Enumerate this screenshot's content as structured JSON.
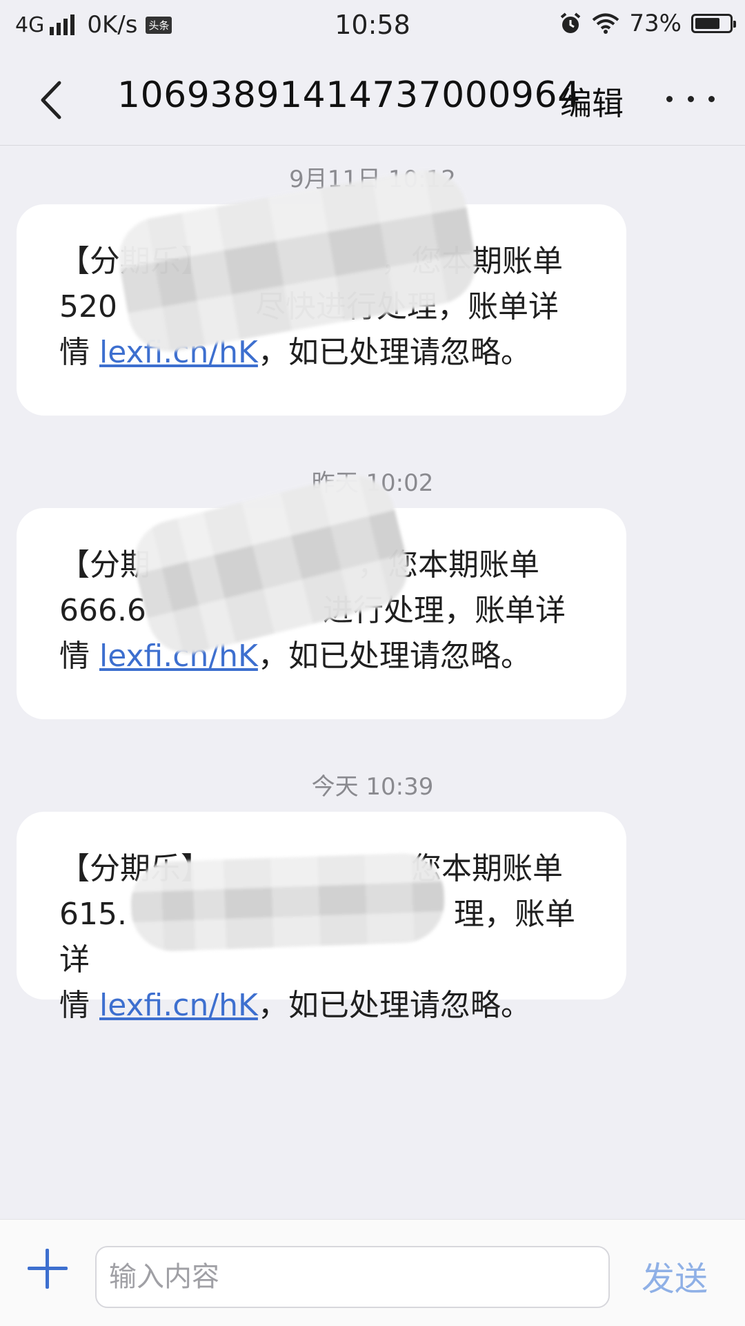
{
  "status_bar": {
    "network": "4G",
    "speed": "0K/s",
    "app_badge": "头条",
    "time": "10:58",
    "battery_percent": "73%",
    "battery_level": 0.73,
    "icons": [
      "signal-icon",
      "alarm-icon",
      "wifi-icon",
      "battery-icon"
    ]
  },
  "header": {
    "title": "1069389141473700096​4",
    "edit_label": "编辑",
    "back_icon": "chevron-left-icon",
    "more_icon": "more-dots-icon"
  },
  "messages": [
    {
      "timestamp": "9月11日 10:12",
      "line1": "【分期乐】",
      "line1_tail": "，您本期账单",
      "line2": "520",
      "line2_tail": "尽快进行处理，账单详",
      "line3": "情 ",
      "link": "lexfi.cn/hK",
      "line3_tail": "，如已处理请忽略。"
    },
    {
      "timestamp": "昨天 10:02",
      "line1": "【分期",
      "line1_tail": "，您本期账单",
      "line2": "666.6",
      "line2_tail": "进行处理，账单详",
      "line3": "情 ",
      "link": "lexfi.cn/hK",
      "line3_tail": "，如已处理请忽略。"
    },
    {
      "timestamp": "今天 10:39",
      "line1": "【分期乐】",
      "line1_tail": "您本期账单",
      "line2": "615.",
      "line2_tail": "理，账单详",
      "line3": "情 ",
      "link": "lexfi.cn/hK",
      "line3_tail": "，如已处理请忽略。"
    }
  ],
  "composer": {
    "placeholder": "输入内容",
    "send_label": "发送",
    "add_icon": "plus-icon"
  }
}
